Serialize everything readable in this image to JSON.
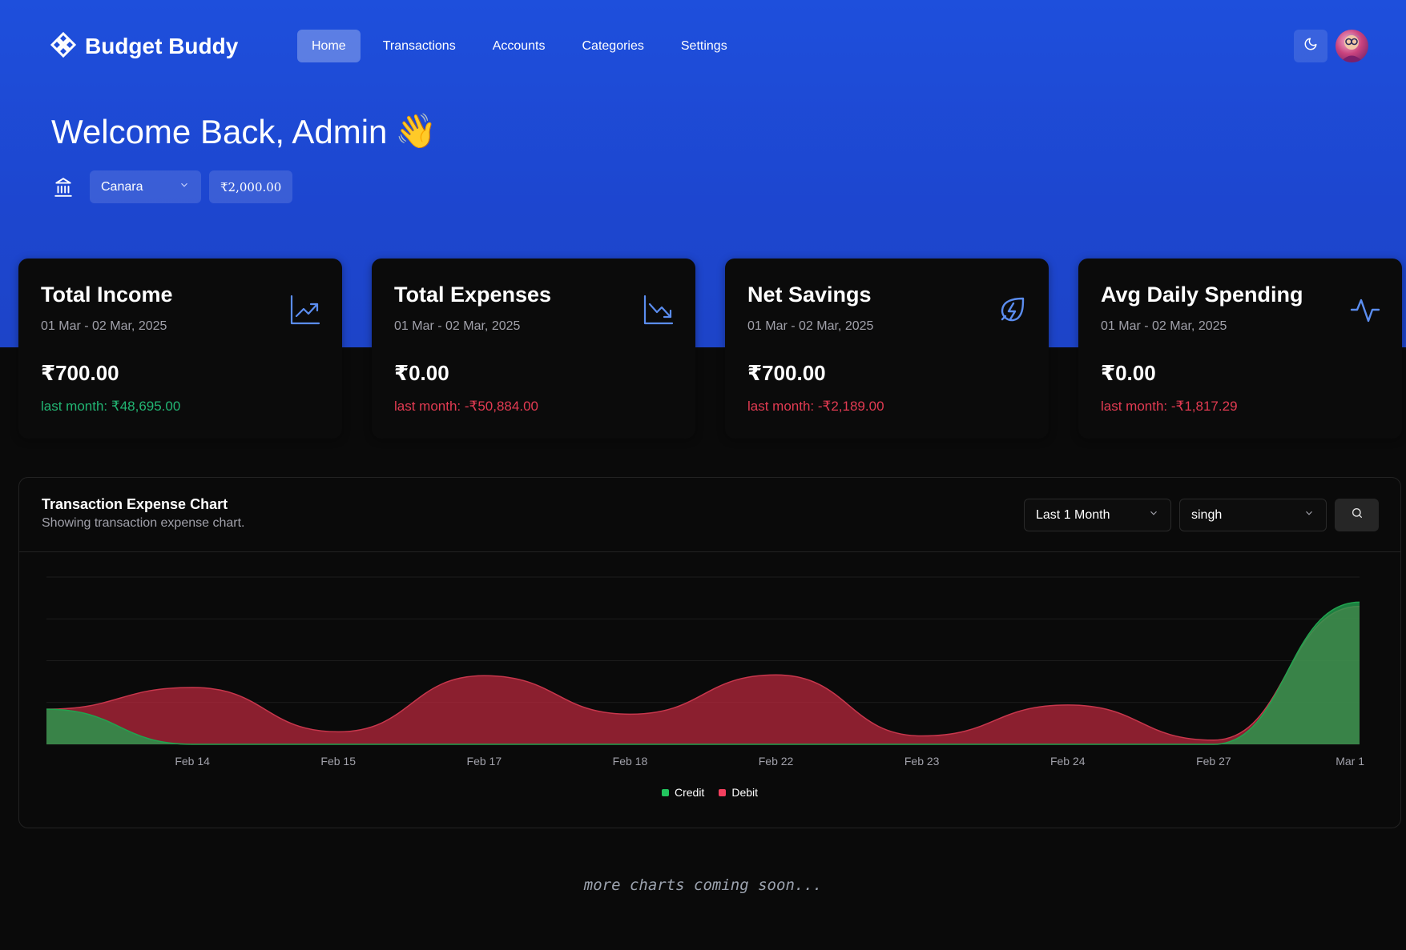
{
  "app": {
    "name": "Budget Buddy",
    "nav": [
      {
        "label": "Home",
        "active": true
      },
      {
        "label": "Transactions",
        "active": false
      },
      {
        "label": "Accounts",
        "active": false
      },
      {
        "label": "Categories",
        "active": false
      },
      {
        "label": "Settings",
        "active": false
      }
    ],
    "icons": {
      "logo": "flower-logo-icon",
      "theme": "moon-icon",
      "avatar": "user-avatar"
    }
  },
  "welcome": {
    "text": "Welcome Back, Admin",
    "emoji": "👋"
  },
  "account": {
    "bank_icon": "bank-icon",
    "selected_bank": "Canara",
    "balance": "₹2,000.00"
  },
  "cards": [
    {
      "title": "Total Income",
      "date": "01 Mar - 02 Mar, 2025",
      "value": "₹700.00",
      "last_month": "last month: ₹48,695.00",
      "trend": "positive",
      "icon": "trending-up-icon"
    },
    {
      "title": "Total Expenses",
      "date": "01 Mar - 02 Mar, 2025",
      "value": "₹0.00",
      "last_month": "last month: -₹50,884.00",
      "trend": "negative",
      "icon": "trending-down-icon"
    },
    {
      "title": "Net Savings",
      "date": "01 Mar - 02 Mar, 2025",
      "value": "₹700.00",
      "last_month": "last month: -₹2,189.00",
      "trend": "negative",
      "icon": "leaf-bolt-icon"
    },
    {
      "title": "Avg Daily Spending",
      "date": "01 Mar - 02 Mar, 2025",
      "value": "₹0.00",
      "last_month": "last month: -₹1,817.29",
      "trend": "negative",
      "icon": "activity-icon"
    }
  ],
  "chart_section": {
    "title": "Transaction Expense Chart",
    "subtitle": "Showing transaction expense chart.",
    "period_select": "Last 1 Month",
    "account_select": "singh",
    "search_icon": "search-icon"
  },
  "chart_data": {
    "type": "area",
    "x": [
      "",
      "Feb 14",
      "Feb 15",
      "Feb 17",
      "Feb 18",
      "Feb 22",
      "Feb 23",
      "Feb 24",
      "Feb 27",
      "Mar 1"
    ],
    "series": [
      {
        "name": "Credit",
        "color": "#1f9a4a",
        "values": [
          42,
          0,
          0,
          0,
          0,
          0,
          0,
          0,
          0,
          170
        ]
      },
      {
        "name": "Debit",
        "color": "#e23b52",
        "values": [
          42,
          68,
          15,
          82,
          36,
          83,
          10,
          47,
          5,
          165
        ]
      }
    ],
    "grid": true,
    "legend": "bottom-center"
  },
  "footer": {
    "text": "more charts coming soon..."
  }
}
